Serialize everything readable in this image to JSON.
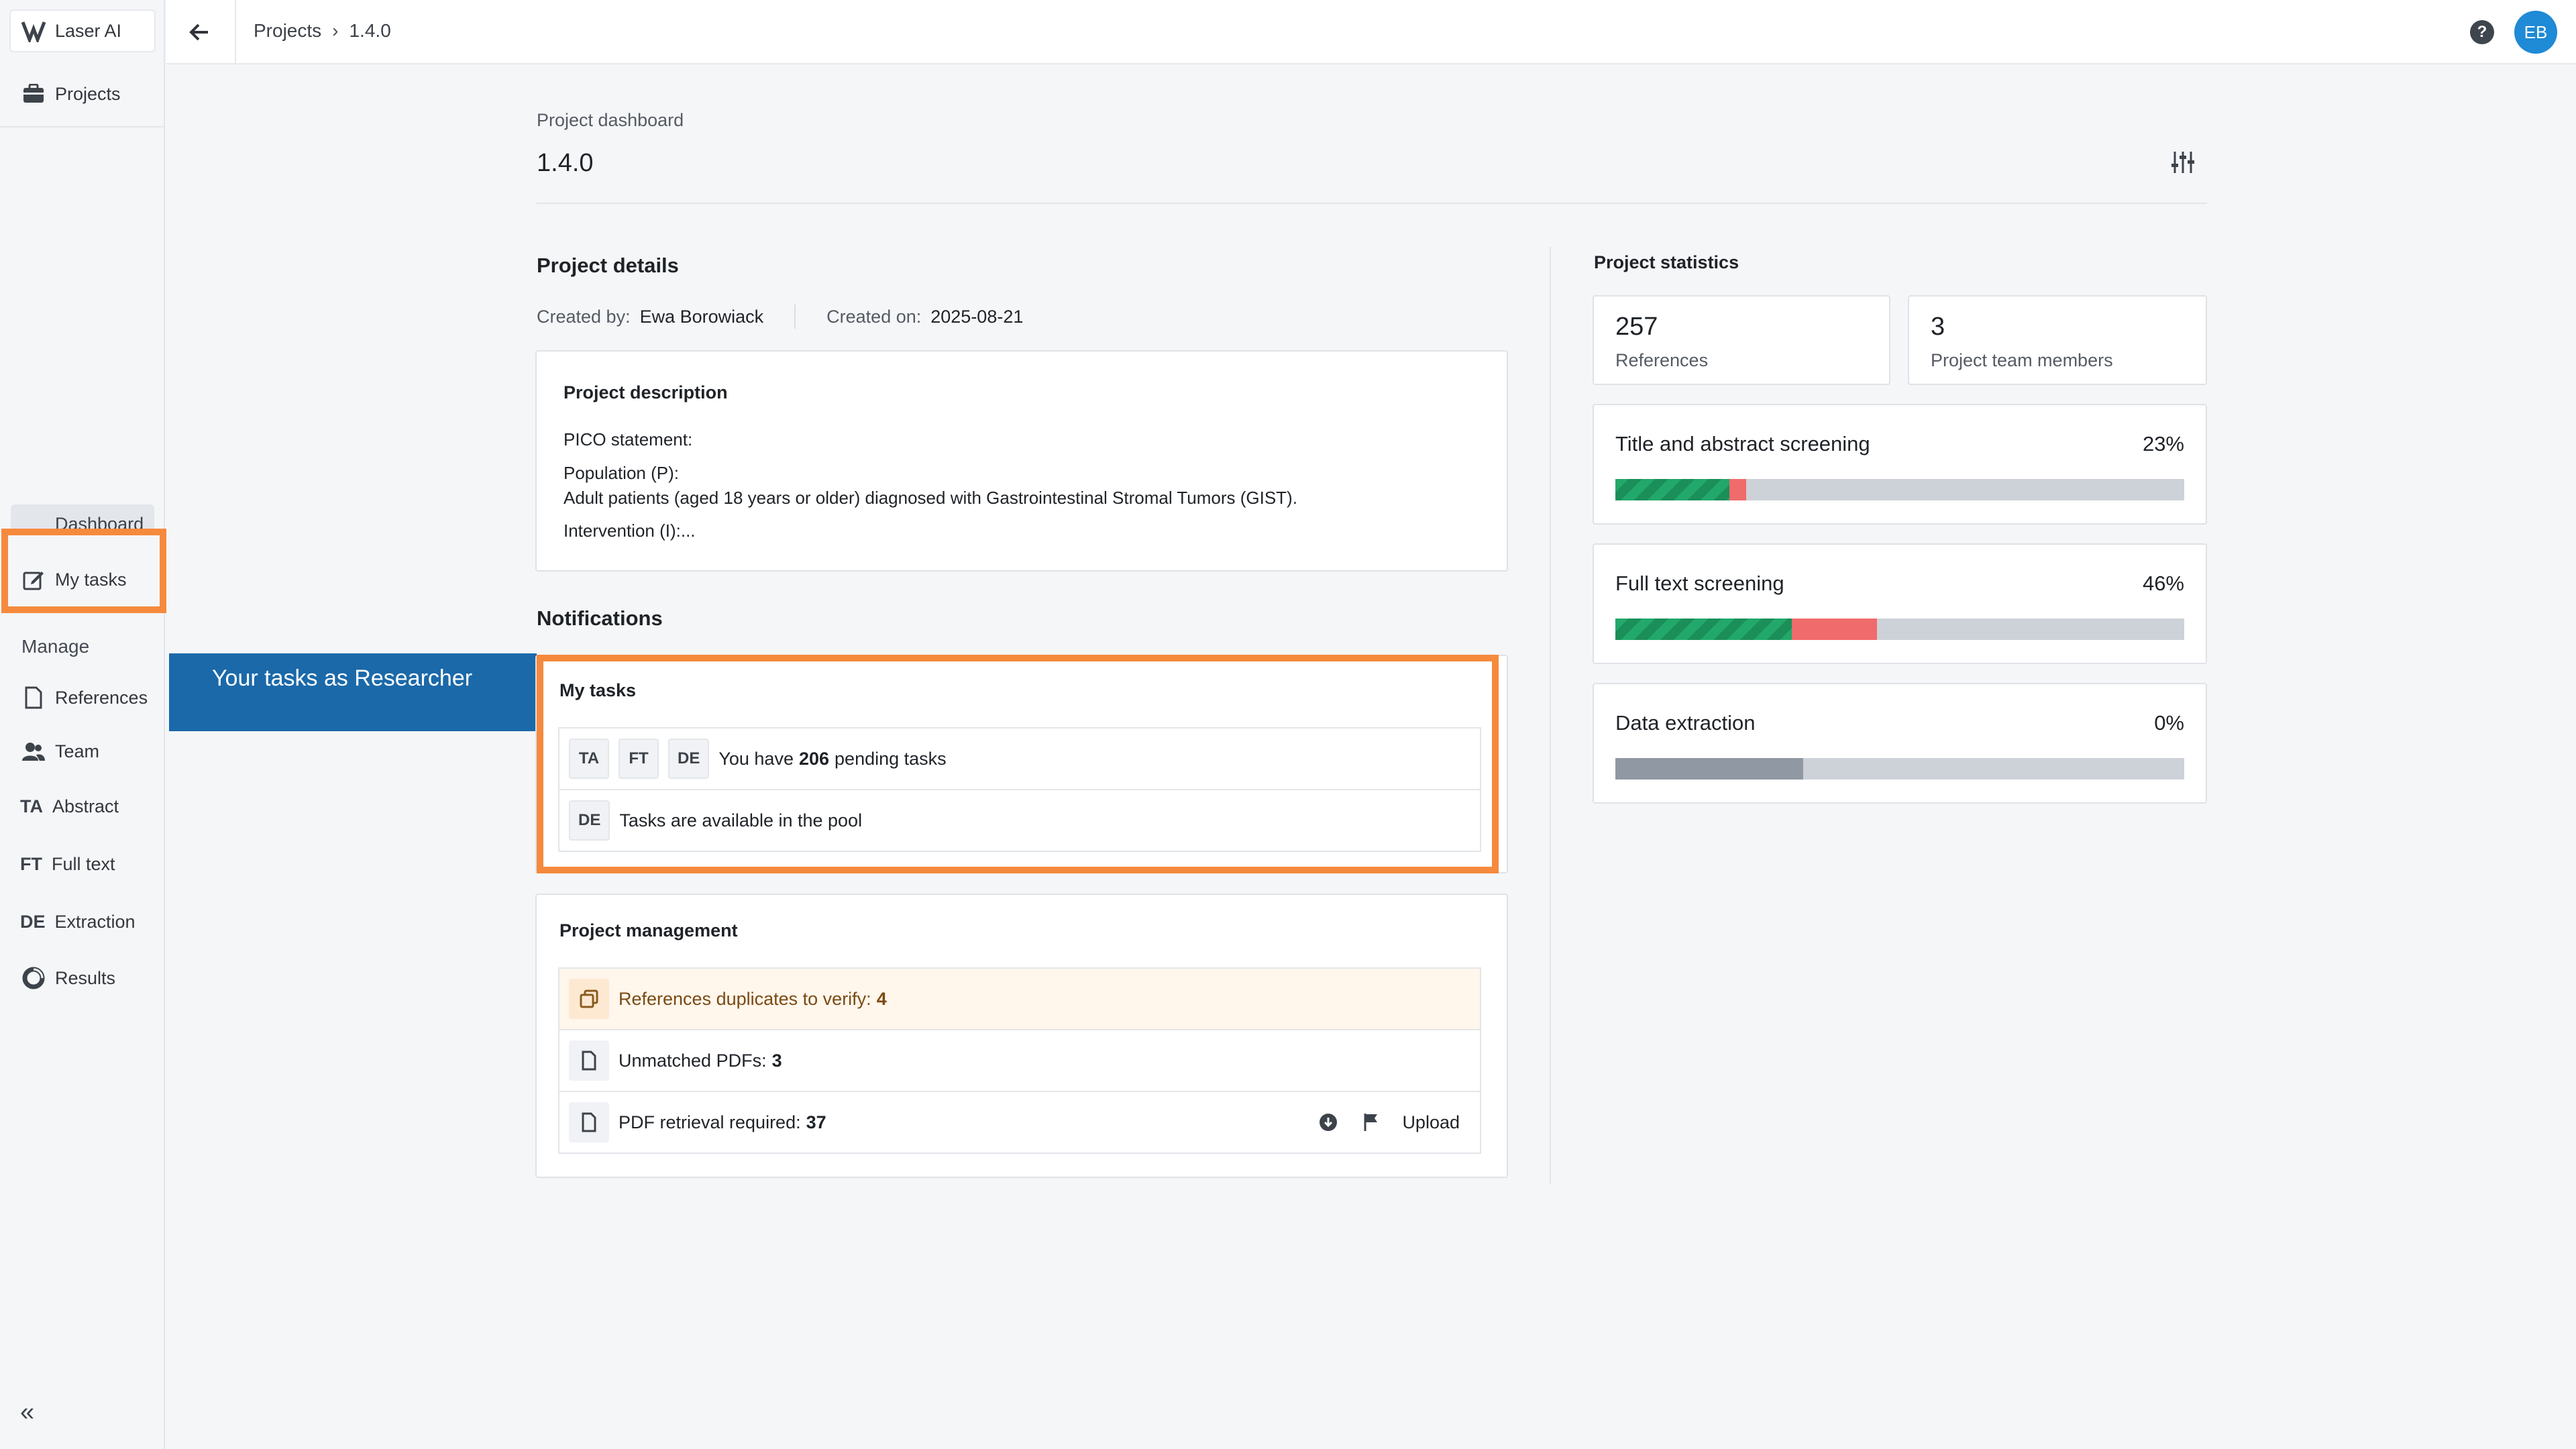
{
  "app": {
    "name": "Laser AI"
  },
  "sidebar": {
    "projects_label": "Projects",
    "dashboard_label": "Dashboard",
    "my_tasks_label": "My tasks",
    "manage_heading": "Manage",
    "items": [
      {
        "label": "References",
        "icon": "document-icon"
      },
      {
        "label": "Team",
        "icon": "team-icon"
      },
      {
        "label": "Abstract",
        "icon_text": "TA"
      },
      {
        "label": "Full text",
        "icon_text": "FT"
      },
      {
        "label": "Extraction",
        "icon_text": "DE"
      },
      {
        "label": "Results",
        "icon": "results-icon"
      }
    ]
  },
  "topbar": {
    "breadcrumb_root": "Projects",
    "breadcrumb_current": "1.4.0",
    "help": "?",
    "avatar_initials": "EB"
  },
  "header": {
    "label": "Project dashboard",
    "title": "1.4.0"
  },
  "details": {
    "title": "Project details",
    "created_by_label": "Created by:",
    "created_by": "Ewa Borowiack",
    "created_on_label": "Created on:",
    "created_on": "2025-08-21",
    "description_title": "Project description",
    "description_lines": [
      "PICO statement:",
      "Population (P):",
      "Adult patients (aged 18 years or older) diagnosed with Gastrointestinal Stromal Tumors (GIST).",
      "Intervention (I):..."
    ]
  },
  "notifications": {
    "title": "Notifications",
    "role_tooltip": "Your tasks as Researcher",
    "my_tasks": {
      "title": "My tasks",
      "tags": [
        "TA",
        "FT",
        "DE"
      ],
      "pending_prefix": "You have",
      "pending_count": "206",
      "pending_suffix": "pending tasks",
      "pool_tag": "DE",
      "pool_text": "Tasks are available in the pool"
    },
    "management": {
      "title": "Project management",
      "duplicates_label": "References duplicates to verify:",
      "duplicates_count": "4",
      "unmatched_label": "Unmatched PDFs:",
      "unmatched_count": "3",
      "retrieval_label": "PDF retrieval required:",
      "retrieval_count": "37",
      "upload_label": "Upload"
    }
  },
  "statistics": {
    "title": "Project statistics",
    "references_count": "257",
    "references_label": "References",
    "team_count": "3",
    "team_label": "Project team members",
    "progress": [
      {
        "name": "Title and abstract screening",
        "pct_label": "23%",
        "included": 0.2,
        "excluded": 0.03,
        "other": 0
      },
      {
        "name": "Full text screening",
        "pct_label": "46%",
        "included": 0.31,
        "excluded": 0.15,
        "other": 0
      },
      {
        "name": "Data extraction",
        "pct_label": "0%",
        "included": 0,
        "excluded": 0,
        "other": 0.33
      }
    ],
    "colors": {
      "included": "#22a86a",
      "excluded": "#f06b6b",
      "other": "#8f98a3",
      "empty": "#cdd2d8"
    }
  },
  "highlight_color": "#f58a3d"
}
